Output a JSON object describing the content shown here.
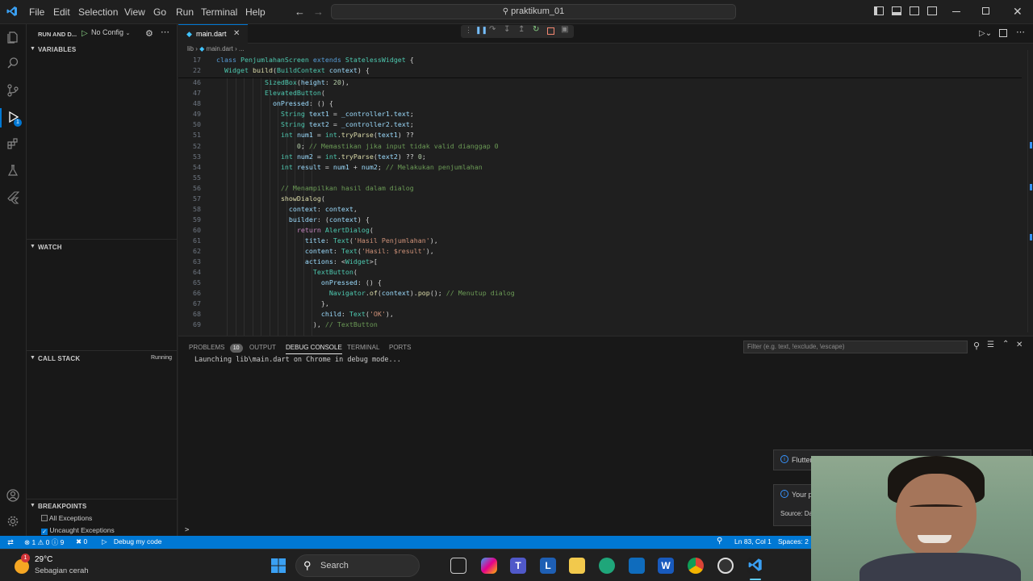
{
  "titlebar": {
    "menus": [
      "File",
      "Edit",
      "Selection",
      "View",
      "Go",
      "Run",
      "Terminal",
      "Help"
    ],
    "search_text": "praktikum_01"
  },
  "sidebar": {
    "run_debug_label": "RUN AND D...",
    "config_label": "No Config",
    "variables_title": "VARIABLES",
    "watch_title": "WATCH",
    "callstack_title": "CALL STACK",
    "callstack_status": "Running",
    "breakpoints_title": "BREAKPOINTS",
    "breakpoints": [
      {
        "label": "All Exceptions",
        "checked": false
      },
      {
        "label": "Uncaught Exceptions",
        "checked": true
      }
    ],
    "debug_badge": "1"
  },
  "editor": {
    "tab_label": "main.dart",
    "breadcrumb_folder": "lib",
    "breadcrumb_file": "main.dart",
    "sticky": [
      {
        "num": "17",
        "html": "<span class=\"kw\">class</span> <span class=\"cls\">PenjumlahanScreen</span> <span class=\"kw\">extends</span> <span class=\"cls\">StatelessWidget</span> {"
      },
      {
        "num": "22",
        "html": "  <span class=\"cls\">Widget</span> <span class=\"fn\">build</span>(<span class=\"cls\">BuildContext</span> <span class=\"var\">context</span>) {"
      }
    ],
    "lines": [
      {
        "num": "46",
        "html": "            <span class=\"cls\">SizedBox</span>(<span class=\"var\">height</span>: <span class=\"num\">20</span>),"
      },
      {
        "num": "47",
        "html": "            <span class=\"cls\">ElevatedButton</span>("
      },
      {
        "num": "48",
        "html": "              <span class=\"var\">onPressed</span>: () {"
      },
      {
        "num": "49",
        "html": "                <span class=\"cls\">String</span> <span class=\"var\">text1</span> = <span class=\"var\">_controller1</span>.<span class=\"var\">text</span>;"
      },
      {
        "num": "50",
        "html": "                <span class=\"cls\">String</span> <span class=\"var\">text2</span> = <span class=\"var\">_controller2</span>.<span class=\"var\">text</span>;"
      },
      {
        "num": "51",
        "html": "                <span class=\"cls\">int</span> <span class=\"var\">num1</span> = <span class=\"cls\">int</span>.<span class=\"fn\">tryParse</span>(<span class=\"var\">text1</span>) ??"
      },
      {
        "num": "52",
        "html": "                    <span class=\"num\">0</span>; <span class=\"cm\">// Memastikan jika input tidak valid dianggap 0</span>"
      },
      {
        "num": "53",
        "html": "                <span class=\"cls\">int</span> <span class=\"var\">num2</span> = <span class=\"cls\">int</span>.<span class=\"fn\">tryParse</span>(<span class=\"var\">text2</span>) ?? <span class=\"num\">0</span>;"
      },
      {
        "num": "54",
        "html": "                <span class=\"cls\">int</span> <span class=\"var\">result</span> = <span class=\"var\">num1</span> + <span class=\"var\">num2</span>; <span class=\"cm\">// Melakukan penjumlahan</span>"
      },
      {
        "num": "55",
        "html": ""
      },
      {
        "num": "56",
        "html": "                <span class=\"cm\">// Menampilkan hasil dalam dialog</span>"
      },
      {
        "num": "57",
        "html": "                <span class=\"fn\">showDialog</span>("
      },
      {
        "num": "58",
        "html": "                  <span class=\"var\">context</span>: <span class=\"var\">context</span>,"
      },
      {
        "num": "59",
        "html": "                  <span class=\"var\">builder</span>: (<span class=\"var\">context</span>) {"
      },
      {
        "num": "60",
        "html": "                    <span class=\"ctrl\">return</span> <span class=\"cls\">AlertDialog</span>("
      },
      {
        "num": "61",
        "html": "                      <span class=\"var\">title</span>: <span class=\"cls\">Text</span>(<span class=\"str\">'Hasil Penjumlahan'</span>),"
      },
      {
        "num": "62",
        "html": "                      <span class=\"var\">content</span>: <span class=\"cls\">Text</span>(<span class=\"str\">'Hasil: $result'</span>),"
      },
      {
        "num": "63",
        "html": "                      <span class=\"var\">actions</span>: &lt;<span class=\"cls\">Widget</span>&gt;["
      },
      {
        "num": "64",
        "html": "                        <span class=\"cls\">TextButton</span>("
      },
      {
        "num": "65",
        "html": "                          <span class=\"var\">onPressed</span>: () {"
      },
      {
        "num": "66",
        "html": "                            <span class=\"cls\">Navigator</span>.<span class=\"fn\">of</span>(<span class=\"var\">context</span>).<span class=\"fn\">pop</span>(); <span class=\"cm\">// Menutup dialog</span>"
      },
      {
        "num": "67",
        "html": "                          },"
      },
      {
        "num": "68",
        "html": "                          <span class=\"var\">child</span>: <span class=\"cls\">Text</span>(<span class=\"str\">'OK'</span>),"
      },
      {
        "num": "69",
        "html": "                        ), <span class=\"cm\">// TextButton</span>"
      }
    ]
  },
  "panel": {
    "tabs": [
      "PROBLEMS",
      "OUTPUT",
      "DEBUG CONSOLE",
      "TERMINAL",
      "PORTS"
    ],
    "problems_count": "10",
    "filter_placeholder": "Filter (e.g. text, !exclude, \\escape)",
    "console_line": "Launching lib\\main.dart on Chrome in debug mode...",
    "prompt": ">"
  },
  "notifications": {
    "flutter_title": "Flutter",
    "your_text": "Your p",
    "source_text": "Source: Da"
  },
  "statusbar": {
    "errors": "1",
    "warnings": "0",
    "infos": "9",
    "ports": "0",
    "debug_text": "Debug my code",
    "position": "Ln 83, Col 1",
    "spaces": "Spaces: 2"
  },
  "taskbar": {
    "temperature": "29°C",
    "weather": "Sebagian cerah",
    "weather_badge": "1",
    "search_label": "Search"
  },
  "colors": {
    "accent": "#0078d4",
    "editor_bg": "#1f1f1f",
    "sidebar_bg": "#181818"
  }
}
